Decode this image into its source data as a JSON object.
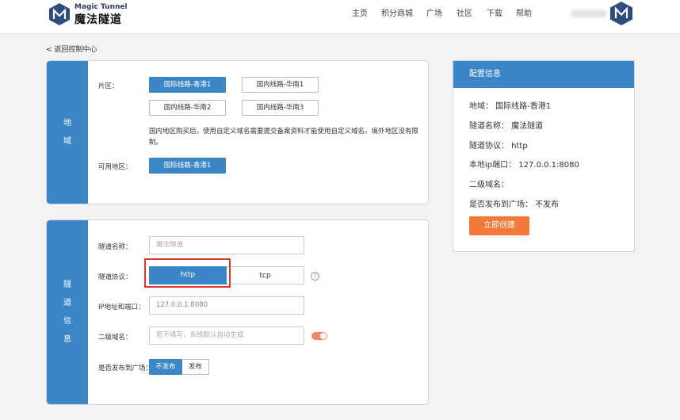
{
  "header": {
    "brand_en": "Magic Tunnel",
    "brand_cn": "魔法隧道",
    "nav": [
      "主页",
      "积分商城",
      "广场",
      "社区",
      "下载",
      "帮助"
    ]
  },
  "back_link": "< 返回控制中心",
  "region": {
    "side_label": [
      "地",
      "域"
    ],
    "zone_label": "片区：",
    "zones": [
      "国际线路-香港1",
      "国内线路-华南1",
      "国内线路-华南2",
      "国内线路-华南3"
    ],
    "selected_zone": "国际线路-香港1",
    "note": "国内地区购买后，使用自定义域名需要提交备案资料才能使用自定义域名。境外地区没有限制。",
    "available_label": "可用地区：",
    "available": "国际线路-香港1"
  },
  "tunnel": {
    "side_label": [
      "隧",
      "道",
      "信",
      "息"
    ],
    "name_label": "隧道名称：",
    "name_placeholder": "魔法隧道",
    "protocol_label": "隧道协议：",
    "protocols": [
      "http",
      "tcp"
    ],
    "selected_protocol": "http",
    "help_glyph": "?",
    "ip_label": "IP地址和端口：",
    "ip_value": "127.0.0.1:8080",
    "subdomain_label": "二级域名：",
    "subdomain_placeholder": "若不填写，系统默认自动生成",
    "publish_label": "是否发布到广场：",
    "publish_options": [
      "不发布",
      "发布"
    ],
    "selected_publish": "不发布"
  },
  "config": {
    "title": "配置信息",
    "rows": [
      "地域： 国际线路-香港1",
      "隧道名称： 魔法隧道",
      "隧道协议： http",
      "本地ip端口： 127.0.0.1:8080",
      "二级域名：",
      "是否发布到广场： 不发布"
    ],
    "create_button": "立即创建"
  },
  "colors": {
    "primary": "#3b86c7",
    "accent": "#f27a36",
    "highlight": "#d9362e"
  }
}
